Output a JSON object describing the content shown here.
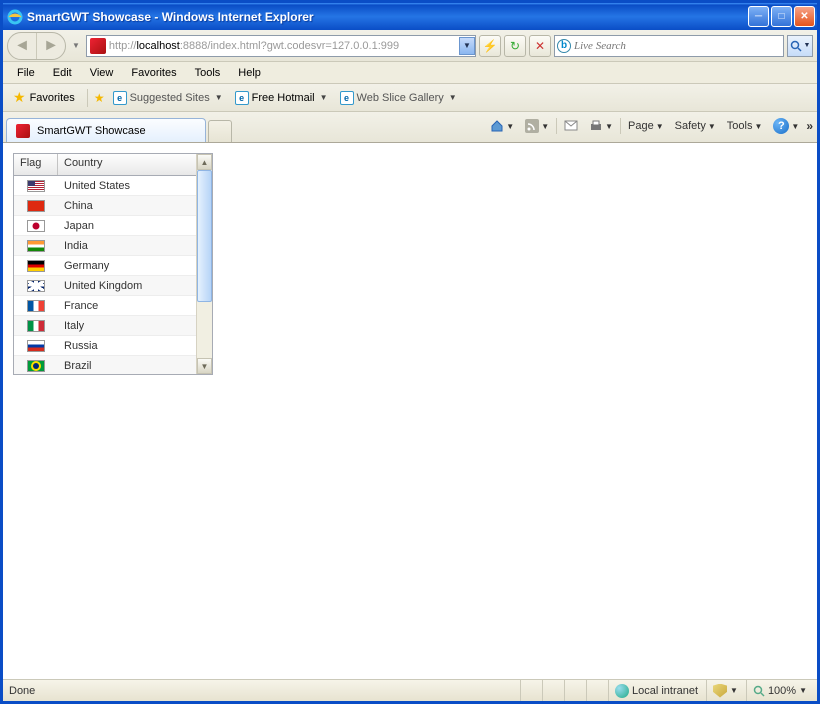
{
  "window": {
    "title": "SmartGWT Showcase - Windows Internet Explorer"
  },
  "address": {
    "protocol": "http://",
    "host": "localhost",
    "rest": ":8888/index.html?gwt.codesvr=127.0.0.1:999"
  },
  "search": {
    "placeholder": "Live Search"
  },
  "menus": [
    "File",
    "Edit",
    "View",
    "Favorites",
    "Tools",
    "Help"
  ],
  "favorites": {
    "label": "Favorites",
    "items": [
      {
        "label": "Suggested Sites"
      },
      {
        "label": "Free Hotmail"
      },
      {
        "label": "Web Slice Gallery"
      }
    ]
  },
  "tab": {
    "label": "SmartGWT Showcase"
  },
  "commandbar": {
    "page": "Page",
    "safety": "Safety",
    "tools": "Tools"
  },
  "grid": {
    "headers": {
      "flag": "Flag",
      "country": "Country"
    },
    "rows": [
      {
        "flagClass": "f-us",
        "country": "United States"
      },
      {
        "flagClass": "f-cn",
        "country": "China"
      },
      {
        "flagClass": "f-jp",
        "country": "Japan"
      },
      {
        "flagClass": "f-in",
        "country": "India"
      },
      {
        "flagClass": "f-de",
        "country": "Germany"
      },
      {
        "flagClass": "f-gb",
        "country": "United Kingdom"
      },
      {
        "flagClass": "f-fr",
        "country": "France"
      },
      {
        "flagClass": "f-it",
        "country": "Italy"
      },
      {
        "flagClass": "f-ru",
        "country": "Russia"
      },
      {
        "flagClass": "f-br",
        "country": "Brazil"
      }
    ]
  },
  "status": {
    "left": "Done",
    "zone": "Local intranet",
    "zoom": "100%"
  }
}
